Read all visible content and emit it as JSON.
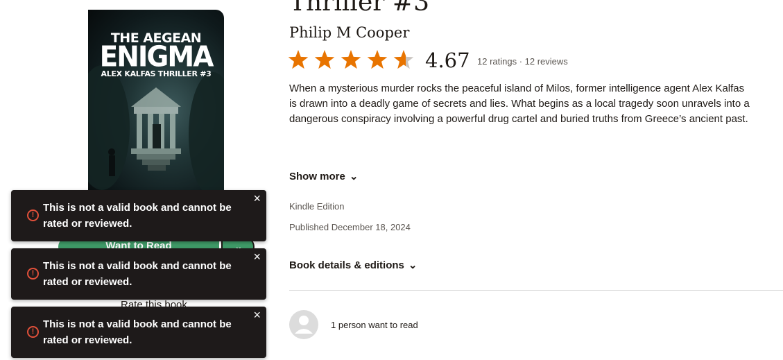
{
  "book": {
    "title_fragment": "Thriller #3",
    "author": "Philip M Cooper",
    "rating": "4.67",
    "rating_stars": 4.67,
    "ratings_reviews": "12 ratings · 12 reviews",
    "description": "When a mysterious murder rocks the peaceful island of Milos, former intelligence agent Alex Kalfas is drawn into a deadly game of secrets and lies. What begins as a local tragedy soon unravels into a dangerous conspiracy involving a powerful drug cartel and buried truths from Greece’s ancient past.",
    "show_more": "Show more",
    "edition": "Kindle Edition",
    "published": "Published December 18, 2024",
    "details_link": "Book details & editions",
    "want_to_read_count": "1 person want to read"
  },
  "cover": {
    "line1": "THE AEGEAN",
    "line2": "ENIGMA",
    "line3": "ALEX KALFAS THRILLER #3"
  },
  "actions": {
    "want_to_read": "Want to Read",
    "rate_book": "Rate this book"
  },
  "toasts": [
    {
      "message": "This is not a valid book and cannot be rated or reviewed."
    },
    {
      "message": "This is not a valid book and cannot be rated or reviewed."
    },
    {
      "message": "This is not a valid book and cannot be rated or reviewed."
    }
  ],
  "icons": {
    "toast_icon": "warning-circle-icon",
    "close": "close-icon",
    "star": "star-icon",
    "chevron": "chevron-down-icon"
  },
  "colors": {
    "star": "#e87400",
    "star_empty": "#c9c4c0",
    "want_button": "#409d69",
    "toast_bg": "#1e1a1a",
    "toast_icon": "#e0503a"
  }
}
